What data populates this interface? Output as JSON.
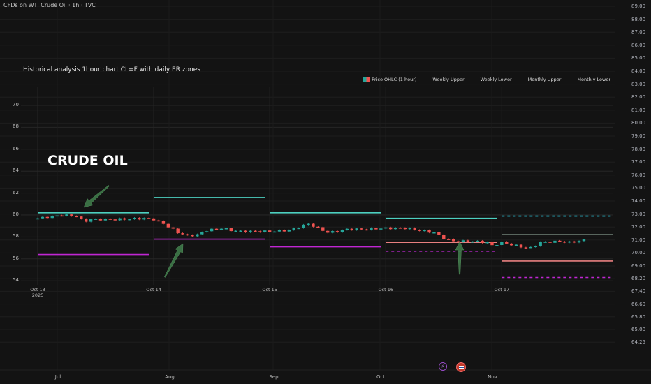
{
  "header": {
    "symbol_title": "CFDs on WTI Crude Oil · 1h · TVC"
  },
  "annotation": {
    "text": "CRUDE OIL"
  },
  "right_axis": {
    "labels": [
      "89.00",
      "88.00",
      "87.00",
      "86.00",
      "85.00",
      "84.00",
      "83.00",
      "82.00",
      "81.00",
      "80.00",
      "79.00",
      "78.00",
      "77.00",
      "76.00",
      "75.00",
      "74.00",
      "73.00",
      "72.00",
      "71.00",
      "70.00",
      "69.00",
      "68.20",
      "67.40",
      "66.60",
      "65.80",
      "65.00",
      "64.25"
    ]
  },
  "bottom_axis": {
    "labels": [
      "Jul",
      "Aug",
      "Sep",
      "Oct",
      "Nov"
    ]
  },
  "bottom_icons": [
    "lightning-icon",
    "us-flag-icon"
  ],
  "colors": {
    "bg": "#131313",
    "up": "#26a69a",
    "down": "#ef5350",
    "weekly_upper": "#4dd0c0",
    "weekly_lower": "#e88080",
    "monthly_upper": "#26c6da",
    "monthly_lower": "#c026d3",
    "arrow": "#3f7a4a"
  },
  "chart_data": {
    "type": "line",
    "title": "Historical analysis 1hour chart CL=F with daily ER zones",
    "xlabel": "",
    "ylabel": "",
    "ylim": [
      53.5,
      71
    ],
    "yticks": [
      54,
      56,
      58,
      60,
      62,
      64,
      66,
      68,
      70
    ],
    "xticks": [
      {
        "label": "Oct 13",
        "sub": "2025",
        "hour": 0
      },
      {
        "label": "Oct 14",
        "hour": 24
      },
      {
        "label": "Oct 15",
        "hour": 48
      },
      {
        "label": "Oct 16",
        "hour": 72
      },
      {
        "label": "Oct 17",
        "hour": 96
      }
    ],
    "legend": [
      "Price OHLC (1 hour)",
      "Weekly Upper",
      "Weekly Lower",
      "Monthly Upper",
      "Monthly Lower"
    ],
    "legend_position": "top-right",
    "price_path": [
      [
        0,
        59.7
      ],
      [
        5,
        60.0
      ],
      [
        8,
        59.9
      ],
      [
        9.5,
        59.4
      ],
      [
        11,
        59.6
      ],
      [
        16,
        59.6
      ],
      [
        22,
        59.7
      ],
      [
        24,
        59.6
      ],
      [
        26,
        59.2
      ],
      [
        29,
        58.4
      ],
      [
        31,
        58.1
      ],
      [
        33,
        58.2
      ],
      [
        35,
        58.6
      ],
      [
        38,
        58.8
      ],
      [
        40,
        58.6
      ],
      [
        42,
        58.5
      ],
      [
        48,
        58.5
      ],
      [
        52,
        58.6
      ],
      [
        56,
        59.2
      ],
      [
        58,
        58.8
      ],
      [
        60,
        58.4
      ],
      [
        62,
        58.5
      ],
      [
        64,
        58.7
      ],
      [
        68,
        58.7
      ],
      [
        72,
        58.8
      ],
      [
        76,
        58.8
      ],
      [
        79,
        58.6
      ],
      [
        82,
        58.4
      ],
      [
        84,
        57.9
      ],
      [
        86,
        57.6
      ],
      [
        90,
        57.6
      ],
      [
        93,
        57.5
      ],
      [
        94,
        57.2
      ],
      [
        96,
        57.5
      ],
      [
        100,
        57.1
      ],
      [
        102,
        57.0
      ],
      [
        104,
        57.5
      ],
      [
        108,
        57.6
      ],
      [
        110,
        57.5
      ],
      [
        113,
        57.7
      ]
    ],
    "levels": [
      {
        "series": "Weekly Upper",
        "day": 0,
        "value": 60.2,
        "style": "solid",
        "color": "#4dd0c0"
      },
      {
        "series": "Monthly Lower",
        "day": 0,
        "value": 56.4,
        "style": "solid",
        "color": "#c026d3"
      },
      {
        "series": "Weekly Upper",
        "day": 1,
        "value": 61.6,
        "style": "solid",
        "color": "#4dd0c0"
      },
      {
        "series": "Monthly Lower",
        "day": 1,
        "value": 57.8,
        "style": "solid",
        "color": "#c026d3"
      },
      {
        "series": "Weekly Upper",
        "day": 2,
        "value": 60.2,
        "style": "solid",
        "color": "#4dd0c0"
      },
      {
        "series": "Monthly Lower",
        "day": 2,
        "value": 57.1,
        "style": "solid",
        "color": "#c026d3"
      },
      {
        "series": "Weekly Upper",
        "day": 3,
        "value": 59.7,
        "style": "solid",
        "color": "#4dd0c0"
      },
      {
        "series": "Weekly Lower",
        "day": 3,
        "value": 57.5,
        "style": "solid",
        "color": "#e88080"
      },
      {
        "series": "Monthly Lower",
        "day": 3,
        "value": 56.7,
        "style": "dashed",
        "color": "#c026d3"
      },
      {
        "series": "Monthly Upper",
        "day": 4,
        "value": 59.9,
        "style": "dashed",
        "color": "#26c6da"
      },
      {
        "series": "Weekly Upper",
        "day": 4,
        "value": 58.2,
        "style": "solid",
        "color": "#9fb8a8"
      },
      {
        "series": "Weekly Lower",
        "day": 4,
        "value": 55.8,
        "style": "solid",
        "color": "#e88080"
      },
      {
        "series": "Monthly Lower",
        "day": 4,
        "value": 54.3,
        "style": "dashed",
        "color": "#c026d3"
      }
    ],
    "arrows": [
      {
        "at_hour": 9,
        "at_price": 59.9,
        "direction": "down-left"
      },
      {
        "at_hour": 30,
        "at_price": 57.7,
        "direction": "up"
      },
      {
        "at_hour": 87,
        "at_price": 57.5,
        "direction": "up"
      }
    ]
  }
}
